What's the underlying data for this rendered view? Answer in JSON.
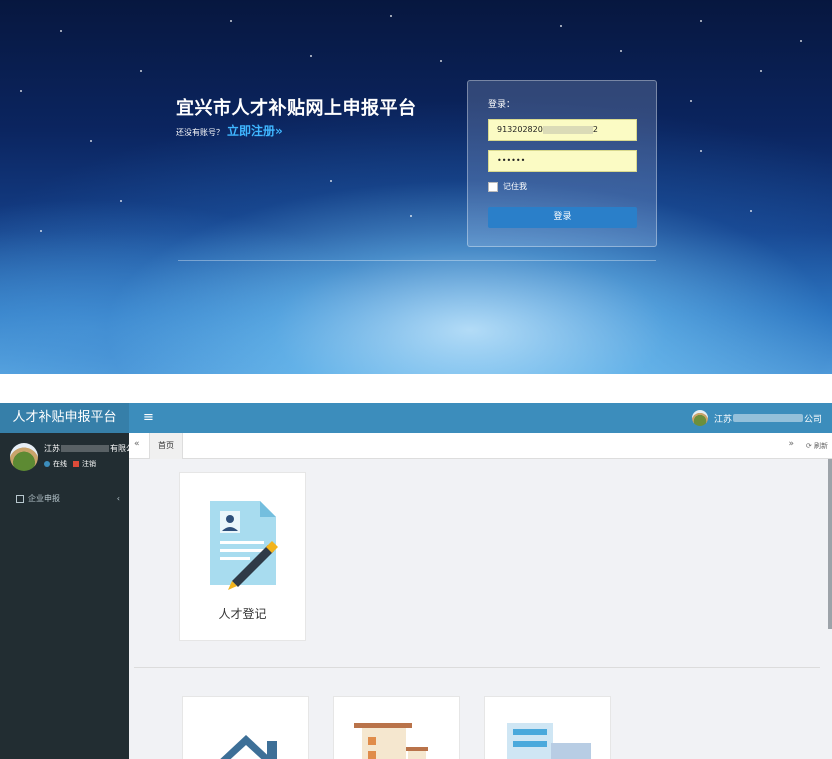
{
  "login": {
    "title": "宜兴市人才补贴网上申报平台",
    "no_account": "还没有账号？",
    "register_link": "立即注册»",
    "box_label": "登录：",
    "username_prefix": "913202820",
    "username_suffix": "2",
    "password_mask": "••••••",
    "remember": "记住我",
    "submit": "登录"
  },
  "dashboard": {
    "brand": "人才补贴申报平台",
    "user_top_prefix": "江苏",
    "user_top_suffix": "公司",
    "sidebar_user_prefix": "江苏",
    "sidebar_user_suffix": "有限公",
    "status_online": "在线",
    "status_logout": "注销",
    "menu_enterprise": "企业申报",
    "tab_home": "首页",
    "refresh": "刷新",
    "card_talent": "人才登记"
  },
  "colors": {
    "topbar": "#3c8dbc",
    "sidebar": "#222d32",
    "login_button": "#2a7fc9",
    "input_fill": "#fbfbc4"
  }
}
